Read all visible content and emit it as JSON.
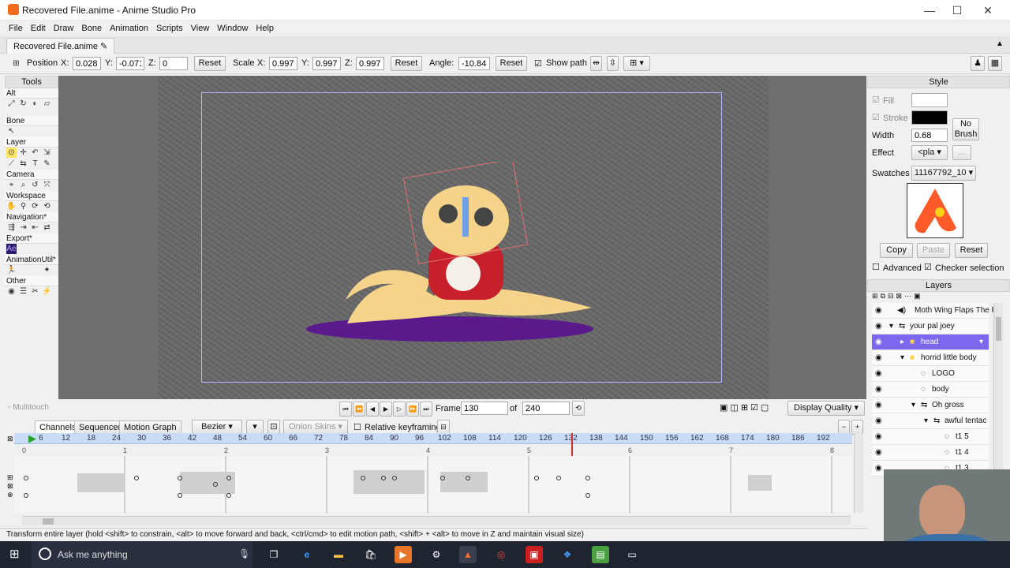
{
  "window": {
    "title": "Recovered File.anime - Anime Studio Pro",
    "min": "—",
    "max": "☐",
    "close": "✕"
  },
  "menu": [
    "File",
    "Edit",
    "Draw",
    "Bone",
    "Animation",
    "Scripts",
    "View",
    "Window",
    "Help"
  ],
  "doc_tab": "Recovered File.anime",
  "tool_options": {
    "position_label": "Position",
    "x_label": "X:",
    "x": "0.0280",
    "y_label": "Y:",
    "y": "-0.0714",
    "z_label": "Z:",
    "z": "0",
    "reset": "Reset",
    "scale_label": "Scale",
    "sx": "0.9976",
    "sy": "0.9976",
    "sz": "0.9976",
    "angle_label": "Angle:",
    "angle": "-10.8485",
    "show_path": "Show path"
  },
  "tools": {
    "title": "Tools",
    "sections": [
      "Alt",
      "Bone",
      "Layer",
      "Camera",
      "Workspace",
      "Navigation*",
      "Export*",
      "AnimationUtil*",
      "Other"
    ]
  },
  "playback": {
    "multitouch": "Multitouch",
    "frame_label": "Frame",
    "frame": "130",
    "of_label": "of",
    "total": "240",
    "display_quality": "Display Quality"
  },
  "timeline": {
    "tabs": [
      "Channels",
      "Sequencer",
      "Motion Graph"
    ],
    "interp": "Bezier",
    "onion": "Onion Skins",
    "relative": "Relative keyframing",
    "ruler": [
      "0",
      "6",
      "12",
      "18",
      "24",
      "30",
      "36",
      "42",
      "48",
      "54",
      "60",
      "66",
      "72",
      "78",
      "84",
      "90",
      "96",
      "102",
      "108",
      "114",
      "120",
      "126",
      "132",
      "138",
      "144",
      "150",
      "156",
      "162",
      "168",
      "174",
      "180",
      "186",
      "192"
    ],
    "seconds": [
      "0",
      "1",
      "2",
      "3",
      "4",
      "5",
      "6",
      "7",
      "8"
    ]
  },
  "status": "Transform entire layer (hold <shift> to constrain, <alt> to move forward and back, <ctrl/cmd> to edit motion path, <shift> + <alt> to move in Z and maintain visual size)",
  "style": {
    "title": "Style",
    "fill": "Fill",
    "stroke": "Stroke",
    "width_label": "Width",
    "width": "0.68",
    "no_brush": "No Brush",
    "effect_label": "Effect",
    "effect": "<pla",
    "swatches_label": "Swatches",
    "swatches": "11167792_10",
    "copy": "Copy",
    "paste": "Paste",
    "reset": "Reset",
    "advanced": "Advanced",
    "checker": "Checker selection"
  },
  "layers": {
    "title": "Layers",
    "items": [
      "Moth Wing Flaps The F",
      "your pal joey",
      "head",
      "horrid little body",
      "LOGO",
      "body",
      "Oh gross",
      "awful tentac",
      "t1 5",
      "t1 4",
      "t1 3"
    ]
  },
  "taskbar": {
    "search": "Ask me anything"
  },
  "colors": {
    "accent": "#7b68ee",
    "stage_bg": "#6a6a6a",
    "frame_border": "#b7b7ff",
    "ruler": "#c8dcf5",
    "playhead": "#d03030"
  }
}
